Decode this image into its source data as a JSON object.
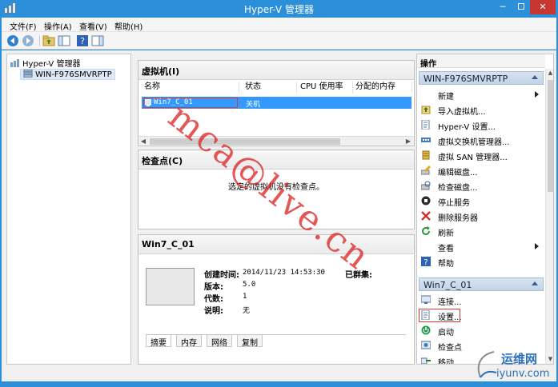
{
  "window": {
    "title": "Hyper-V 管理器",
    "min_glyph": "─",
    "close_glyph": "✕"
  },
  "menu": [
    "文件(F)",
    "操作(A)",
    "查看(V)",
    "帮助(H)"
  ],
  "toolbar": {
    "icons": [
      "back-arrow-icon",
      "forward-arrow-icon",
      "up-folder-icon",
      "console-tree-icon",
      "help-icon",
      "action-pane-icon"
    ]
  },
  "tree": {
    "root": "Hyper-V 管理器",
    "server": "WIN-F976SMVRPTP"
  },
  "vms": {
    "title": "虚拟机(I)",
    "columns": [
      "名称",
      "状态",
      "CPU 使用率",
      "分配的内存"
    ],
    "rows": [
      {
        "name": "Win7_C_01",
        "state": "关机",
        "cpu": "",
        "memory": ""
      }
    ]
  },
  "checkpoints": {
    "title": "检查点(C)",
    "empty_message": "选定的虚拟机没有检查点。"
  },
  "details": {
    "title": "Win7_C_01",
    "created_label": "创建时间:",
    "created_value": "2014/11/23 14:53:30",
    "clustered_label": "已群集:",
    "version_label": "版本:",
    "version_value": "5.0",
    "generation_label": "代数:",
    "generation_value": "1",
    "notes_label": "说明:",
    "notes_value": "无",
    "tabs": [
      "摘要",
      "内存",
      "网络",
      "复制"
    ]
  },
  "actions": {
    "title": "操作",
    "server_group": "WIN-F976SMVRPTP",
    "server_items": [
      {
        "label": "新建",
        "icon": "blank",
        "submenu": true
      },
      {
        "label": "导入虚拟机...",
        "icon": "import-icon"
      },
      {
        "label": "Hyper-V 设置...",
        "icon": "settings-page-icon"
      },
      {
        "label": "虚拟交换机管理器...",
        "icon": "switch-icon"
      },
      {
        "label": "虚拟 SAN 管理器...",
        "icon": "san-icon"
      },
      {
        "label": "编辑磁盘...",
        "icon": "edit-disk-icon"
      },
      {
        "label": "检查磁盘...",
        "icon": "inspect-disk-icon"
      },
      {
        "label": "停止服务",
        "icon": "stop-icon"
      },
      {
        "label": "删除服务器",
        "icon": "delete-x-icon"
      },
      {
        "label": "刷新",
        "icon": "refresh-icon"
      },
      {
        "label": "查看",
        "icon": "blank",
        "submenu": true
      },
      {
        "label": "帮助",
        "icon": "help-icon"
      }
    ],
    "vm_group": "Win7_C_01",
    "vm_items": [
      {
        "label": "连接...",
        "icon": "connect-icon"
      },
      {
        "label": "设置...",
        "icon": "settings-page-icon"
      },
      {
        "label": "启动",
        "icon": "power-icon"
      },
      {
        "label": "检查点",
        "icon": "checkpoint-icon"
      },
      {
        "label": "移动...",
        "icon": "move-icon"
      }
    ]
  },
  "overlay": {
    "watermark": "mca@live.cn",
    "site_brand": "运维网",
    "site_domain": "iyunv.com"
  },
  "colors": {
    "titlebar": "#2b8fd9",
    "selection": "#3399ff",
    "highlight_box": "#d93a2b",
    "close_button": "#c7362f"
  }
}
